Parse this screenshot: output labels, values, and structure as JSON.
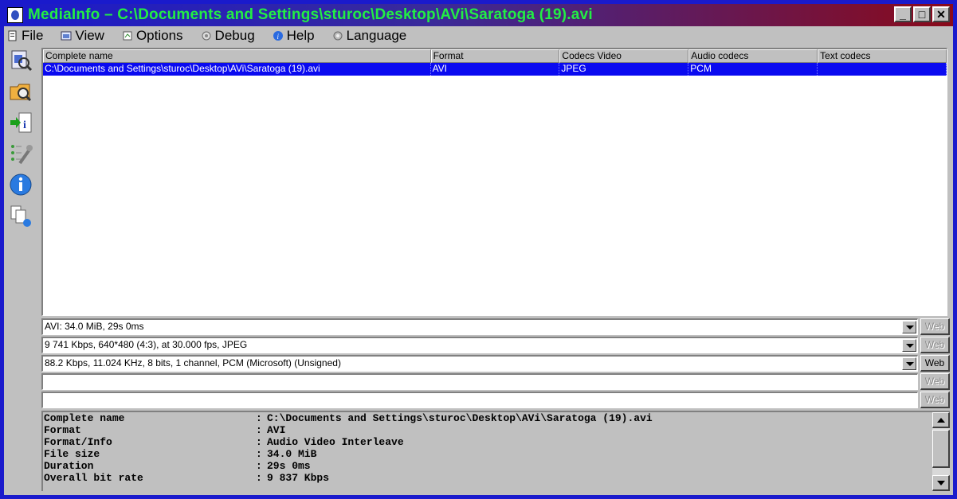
{
  "window": {
    "title": "MediaInfo – C:\\Documents and Settings\\sturoc\\Desktop\\AVi\\Saratoga (19).avi",
    "minimize_label": "_",
    "maximize_label": "□",
    "close_label": "✕"
  },
  "menu": [
    {
      "label": "File",
      "icon": "file-icon"
    },
    {
      "label": "View",
      "icon": "view-icon"
    },
    {
      "label": "Options",
      "icon": "options-icon"
    },
    {
      "label": "Debug",
      "icon": "debug-icon"
    },
    {
      "label": "Help",
      "icon": "help-icon"
    },
    {
      "label": "Language",
      "icon": "language-icon"
    }
  ],
  "toolbar": [
    {
      "icon": "open-file-icon"
    },
    {
      "icon": "open-folder-icon"
    },
    {
      "icon": "export-icon"
    },
    {
      "icon": "preferences-icon"
    },
    {
      "icon": "about-icon"
    },
    {
      "icon": "copy-icon"
    }
  ],
  "list": {
    "columns": [
      "Complete name",
      "Format",
      "Codecs Video",
      "Audio codecs",
      "Text codecs"
    ],
    "rows": [
      [
        "C:\\Documents and Settings\\sturoc\\Desktop\\AVi\\Saratoga (19).avi",
        "AVI",
        "JPEG",
        "PCM",
        ""
      ]
    ]
  },
  "summary": {
    "general": "AVI: 34.0 MiB, 29s 0ms",
    "video": "9 741 Kbps, 640*480 (4:3), at 30.000 fps, JPEG",
    "audio": "88.2 Kbps, 11.024 KHz, 8 bits, 1 channel, PCM (Microsoft) (Unsigned)",
    "web_label": "Web"
  },
  "info": [
    {
      "label": "Complete name",
      "sep": ":",
      "value": "C:\\Documents and Settings\\sturoc\\Desktop\\AVi\\Saratoga (19).avi"
    },
    {
      "label": "Format",
      "sep": ":",
      "value": "AVI"
    },
    {
      "label": "Format/Info",
      "sep": ":",
      "value": "Audio Video Interleave"
    },
    {
      "label": "File size",
      "sep": ":",
      "value": "34.0 MiB"
    },
    {
      "label": "Duration",
      "sep": ":",
      "value": "29s 0ms"
    },
    {
      "label": "Overall bit rate",
      "sep": ":",
      "value": "9 837 Kbps"
    }
  ],
  "colors": {
    "title_text": "#22ee44",
    "selection": "#0a0af0",
    "frame": "#1a1acc"
  }
}
